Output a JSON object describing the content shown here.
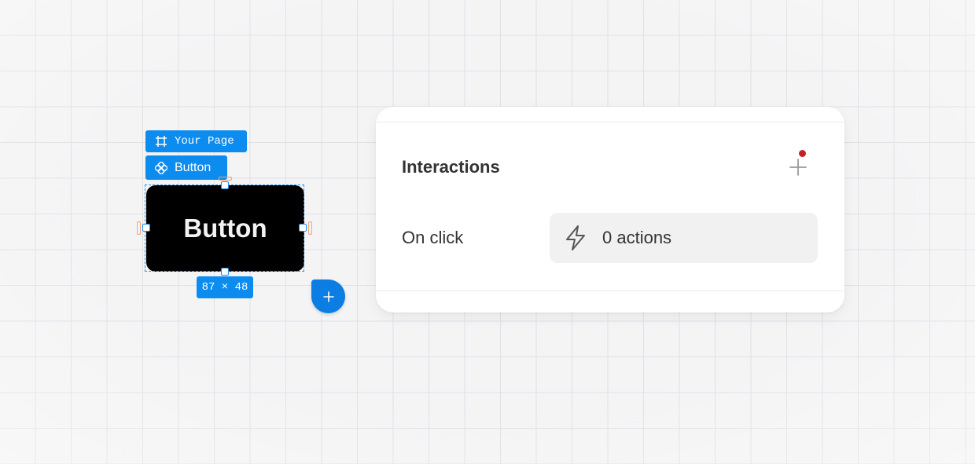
{
  "canvas": {
    "page_tag": {
      "label": "Your Page",
      "icon": "frame-icon"
    },
    "component_tag": {
      "label": "Button",
      "icon": "component-icon"
    },
    "element": {
      "label": "Button"
    },
    "size_badge": {
      "label": "87 × 48"
    },
    "add_button": {
      "icon": "plus-icon"
    }
  },
  "panel": {
    "title": "Interactions",
    "add_icon": "plus-icon",
    "has_notification": true,
    "trigger": {
      "label": "On click",
      "icon": "lightning-icon",
      "value": "0 actions"
    }
  },
  "colors": {
    "selection": "#0d8cf0",
    "element_bg": "#000000",
    "notification_dot": "#c2212a",
    "canvas_bg": "#f4f4f5"
  }
}
